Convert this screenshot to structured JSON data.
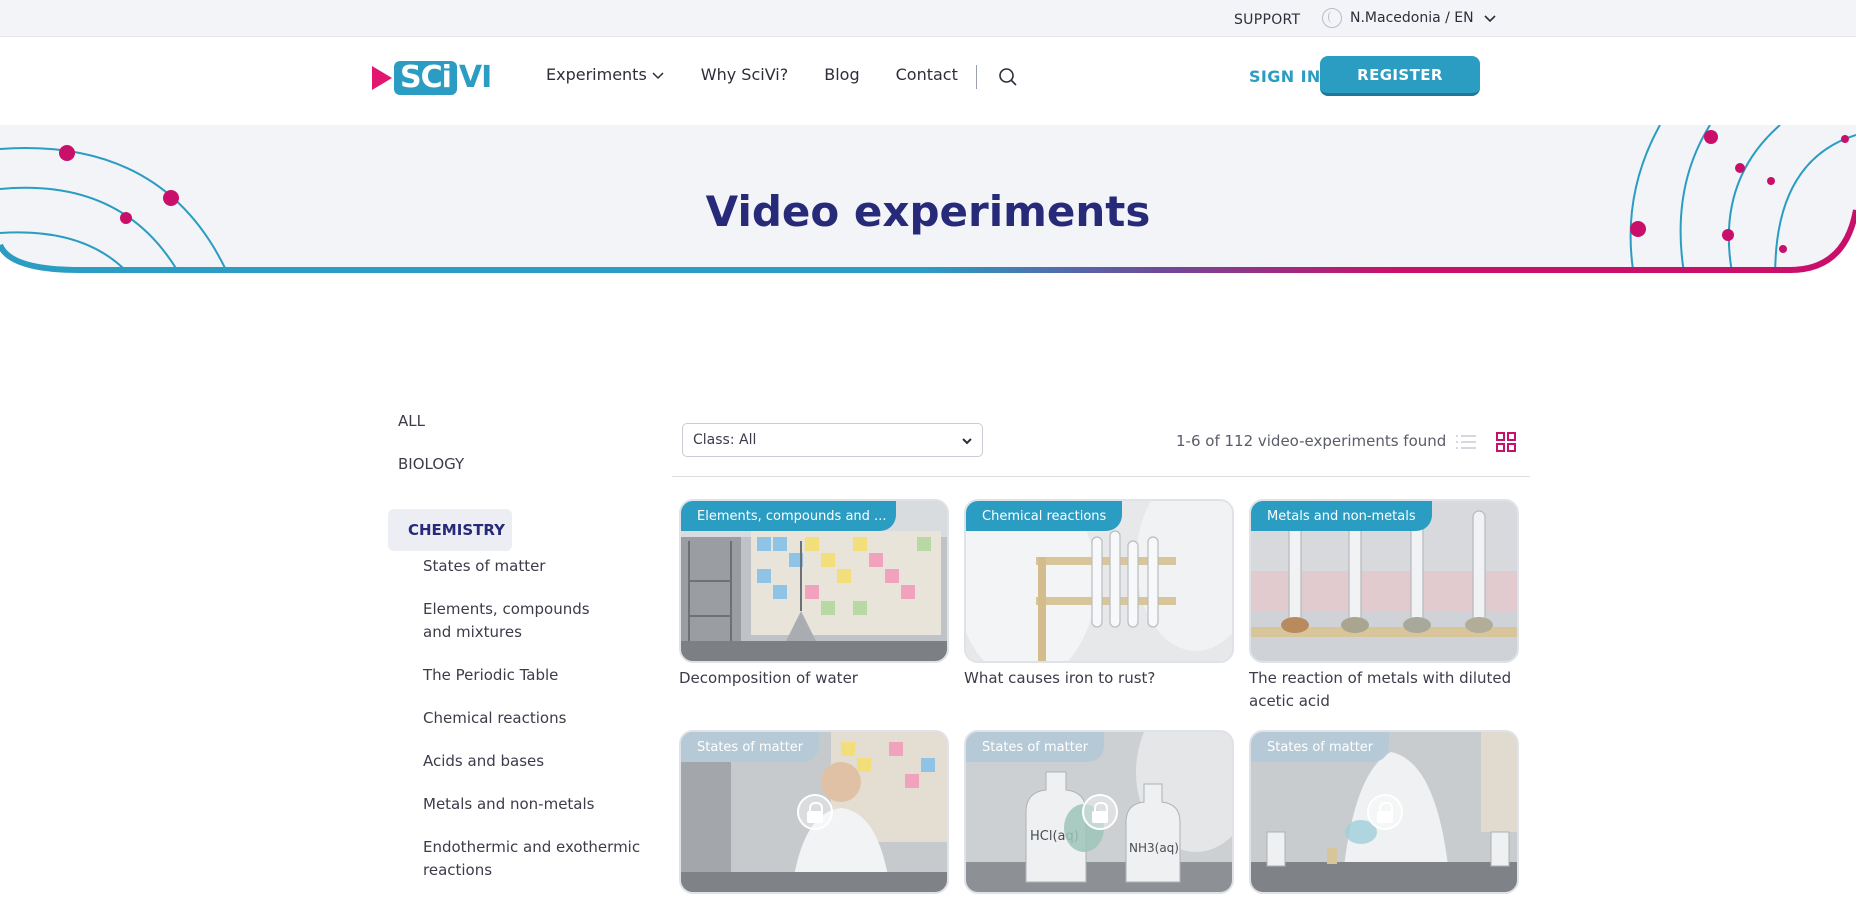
{
  "topbar": {
    "support_label": "SUPPORT",
    "language_label": "N.Macedonia / EN"
  },
  "header": {
    "logo_text": "SCi",
    "logo_text_vi": "VI",
    "nav": [
      {
        "label": "Experiments",
        "has_dropdown": true
      },
      {
        "label": "Why SciVi?"
      },
      {
        "label": "Blog"
      },
      {
        "label": "Contact"
      }
    ],
    "signin_label": "SIGN IN",
    "register_label": "REGISTER"
  },
  "hero": {
    "title": "Video experiments",
    "colors": {
      "teal": "#2b9cc2",
      "magenta": "#c8106b",
      "navy": "#272a78"
    }
  },
  "sidebar": {
    "all_label": "ALL",
    "biology_label": "BIOLOGY",
    "active_label": "CHEMISTRY",
    "items": [
      "States of matter",
      "Elements, compounds and mixtures",
      "The Periodic Table",
      "Chemical reactions",
      "Acids and bases",
      "Metals and non-metals",
      "Endothermic and exothermic reactions"
    ]
  },
  "content": {
    "filter_value": "Class: All",
    "results_text": "1-6 of 112 video-experiments found",
    "active_view": "grid",
    "cards": [
      {
        "tag": "Elements, compounds and ...",
        "title": "Decomposition of water",
        "locked": false
      },
      {
        "tag": "Chemical reactions",
        "title": "What causes iron to rust?",
        "locked": false
      },
      {
        "tag": "Metals and non-metals",
        "title": "The reaction of metals with diluted acetic acid",
        "locked": false
      },
      {
        "tag": "States of matter",
        "title": "",
        "locked": true
      },
      {
        "tag": "States of matter",
        "title": "",
        "locked": true,
        "image_labels": [
          "HCl(aq)",
          "NH3(aq)"
        ]
      },
      {
        "tag": "States of matter",
        "title": "",
        "locked": true
      }
    ]
  }
}
